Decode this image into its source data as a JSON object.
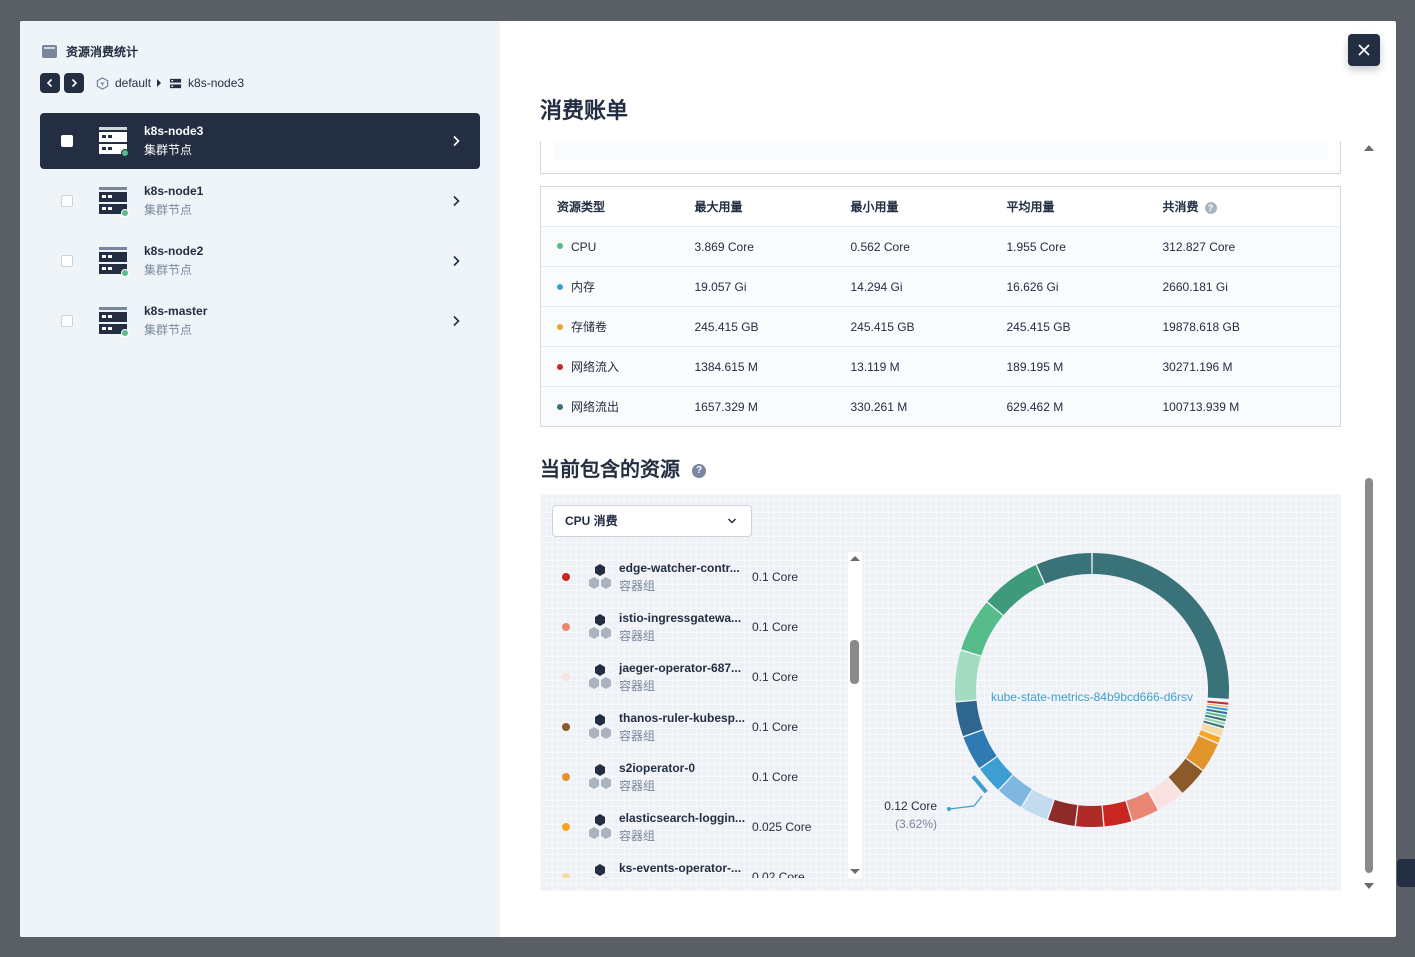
{
  "sidebar": {
    "title": "资源消费统计",
    "breadcrumb": {
      "workspace": "default",
      "node": "k8s-node3"
    },
    "nodes": [
      {
        "name": "k8s-node3",
        "type": "集群节点",
        "active": true
      },
      {
        "name": "k8s-node1",
        "type": "集群节点",
        "active": false
      },
      {
        "name": "k8s-node2",
        "type": "集群节点",
        "active": false
      },
      {
        "name": "k8s-master",
        "type": "集群节点",
        "active": false
      }
    ]
  },
  "bill": {
    "title": "消费账单",
    "headers": [
      "资源类型",
      "最大用量",
      "最小用量",
      "平均用量",
      "共消费"
    ],
    "rows": [
      {
        "name": "CPU",
        "color": "#55bc8a",
        "max": "3.869 Core",
        "min": "0.562 Core",
        "avg": "1.955 Core",
        "total": "312.827 Core"
      },
      {
        "name": "内存",
        "color": "#3d9fd1",
        "max": "19.057 Gi",
        "min": "14.294 Gi",
        "avg": "16.626 Gi",
        "total": "2660.181 Gi"
      },
      {
        "name": "存储卷",
        "color": "#f5a623",
        "max": "245.415 GB",
        "min": "245.415 GB",
        "avg": "245.415 GB",
        "total": "19878.618 GB"
      },
      {
        "name": "网络流入",
        "color": "#ca2621",
        "max": "1384.615 M",
        "min": "13.119 M",
        "avg": "189.195 M",
        "total": "30271.196 M"
      },
      {
        "name": "网络流出",
        "color": "#3a7279",
        "max": "1657.329 M",
        "min": "330.261 M",
        "avg": "629.462 M",
        "total": "100713.939 M"
      }
    ]
  },
  "resources": {
    "title": "当前包含的资源",
    "select_value": "CPU 消费",
    "items": [
      {
        "name": "edge-watcher-contr...",
        "type": "容器组",
        "value": "0.1 Core",
        "color": "#ca2621"
      },
      {
        "name": "istio-ingressgatewa...",
        "type": "容器组",
        "value": "0.1 Core",
        "color": "#ea8573"
      },
      {
        "name": "jaeger-operator-687...",
        "type": "容器组",
        "value": "0.1 Core",
        "color": "#fae2e0"
      },
      {
        "name": "thanos-ruler-kubesp...",
        "type": "容器组",
        "value": "0.1 Core",
        "color": "#8b5a2b"
      },
      {
        "name": "s2ioperator-0",
        "type": "容器组",
        "value": "0.1 Core",
        "color": "#e3952d"
      },
      {
        "name": "elasticsearch-loggin...",
        "type": "容器组",
        "value": "0.025 Core",
        "color": "#f5a623"
      },
      {
        "name": "ks-events-operator-...",
        "type": "容器组",
        "value": "0.02 Core",
        "color": "#f8d9a8"
      }
    ],
    "donut": {
      "center_label": "kube-state-metrics-84b9bcd666-d6rsv",
      "tooltip_value": "0.12 Core",
      "tooltip_percent": "(3.62%)"
    }
  },
  "colors": {
    "primary": "#242e42",
    "success": "#55bc8a",
    "background": "#eff4f9"
  }
}
